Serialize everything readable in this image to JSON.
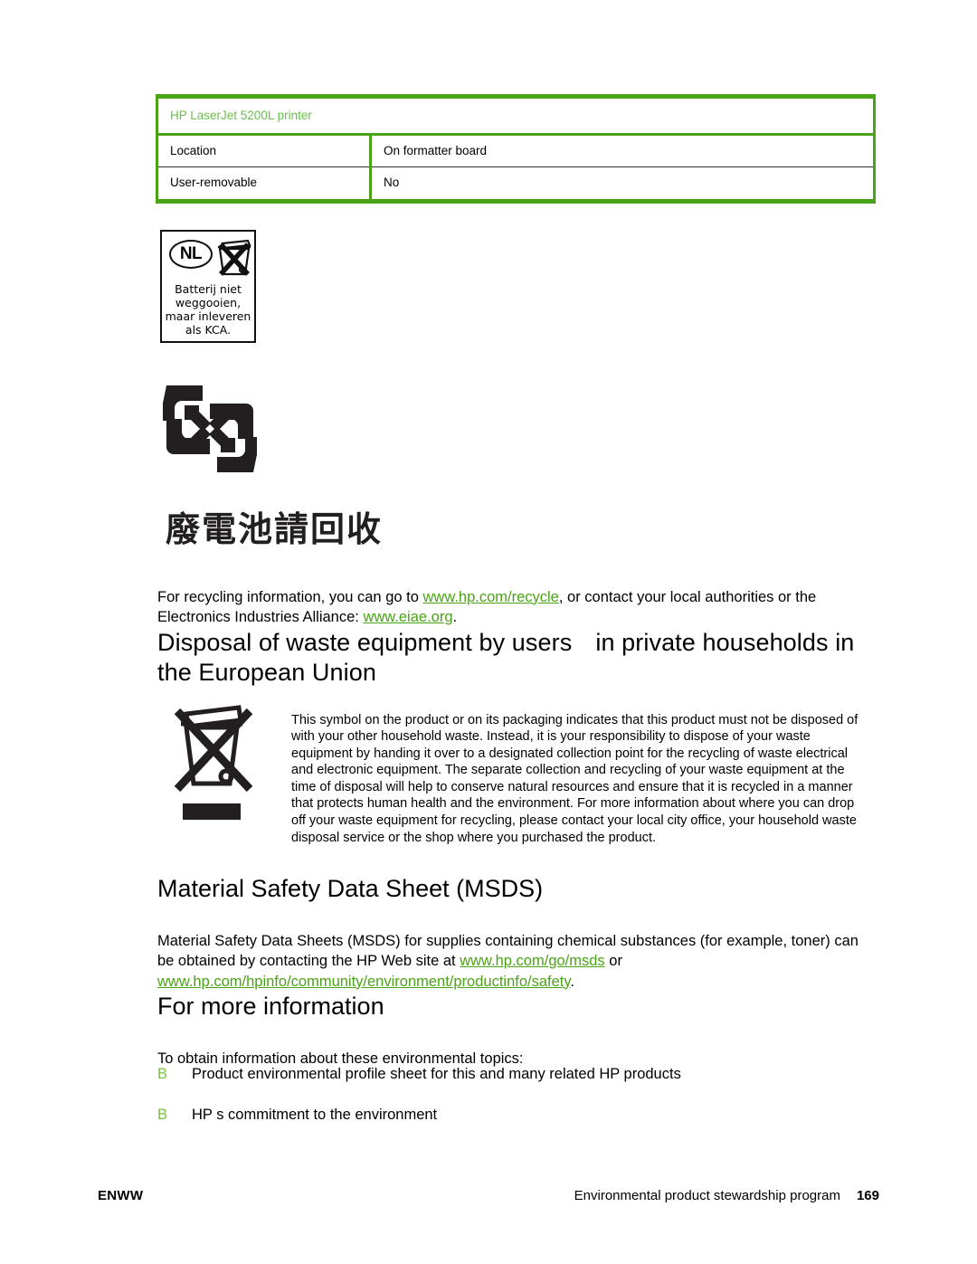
{
  "spec_table": {
    "header": "HP LaserJet 5200L printer",
    "rows": [
      {
        "label": "Location",
        "value": "On formatter board"
      },
      {
        "label": "User-removable",
        "value": "No"
      }
    ]
  },
  "nl_battery_label": {
    "country_code": "NL",
    "line1": "Batterij niet",
    "line2": "weggooien,",
    "line3": "maar inleveren",
    "line4": "als KCA."
  },
  "taiwan_recycle": {
    "heading": "廢電池請回收"
  },
  "recycling_paragraph": {
    "part1": "For recycling information, you can go to ",
    "link1": "www.hp.com/recycle",
    "part2": ", or contact your local authorities or the Electronics Industries Alliance: ",
    "link2": "www.eiae.org",
    "part3": "."
  },
  "eu_disposal": {
    "heading_part1": "Disposal of waste equipment by users",
    "heading_part2": "in private households in the European Union",
    "body": "This symbol on the product or on its packaging indicates that this product must not be disposed of with your other household waste. Instead, it is your responsibility to dispose of your waste equipment by handing it over to a designated collection point for the recycling of waste electrical and electronic equipment. The separate collection and recycling of your waste equipment at the time of disposal will help to conserve natural resources and ensure that it is recycled in a manner that protects human health and the environment. For more information about where you can drop off your waste equipment for recycling, please contact your local city office, your household waste disposal service or the shop where you purchased the product."
  },
  "msds": {
    "heading": "Material Safety Data Sheet (MSDS)",
    "part1": "Material Safety Data Sheets (MSDS) for supplies containing chemical substances (for example, toner) can be obtained by contacting the HP Web site at ",
    "link1": "www.hp.com/go/msds",
    "part2": " or ",
    "link2": "www.hp.com/hpinfo/community/environment/productinfo/safety",
    "part3": "."
  },
  "more_info": {
    "heading": "For more information",
    "intro": "To obtain information about these environmental topics:",
    "bullet_glyph": "B",
    "items": [
      "Product environmental profile sheet for this and many related HP products",
      "HP s commitment to the environment"
    ]
  },
  "footer": {
    "left": "ENWW",
    "title": "Environmental product stewardship program",
    "page_number": "169"
  },
  "colors": {
    "table_border_green": "#4aa316",
    "table_header_green": "#6abf4b",
    "link_green": "#4aa316",
    "bullet_green": "#7ac143"
  }
}
